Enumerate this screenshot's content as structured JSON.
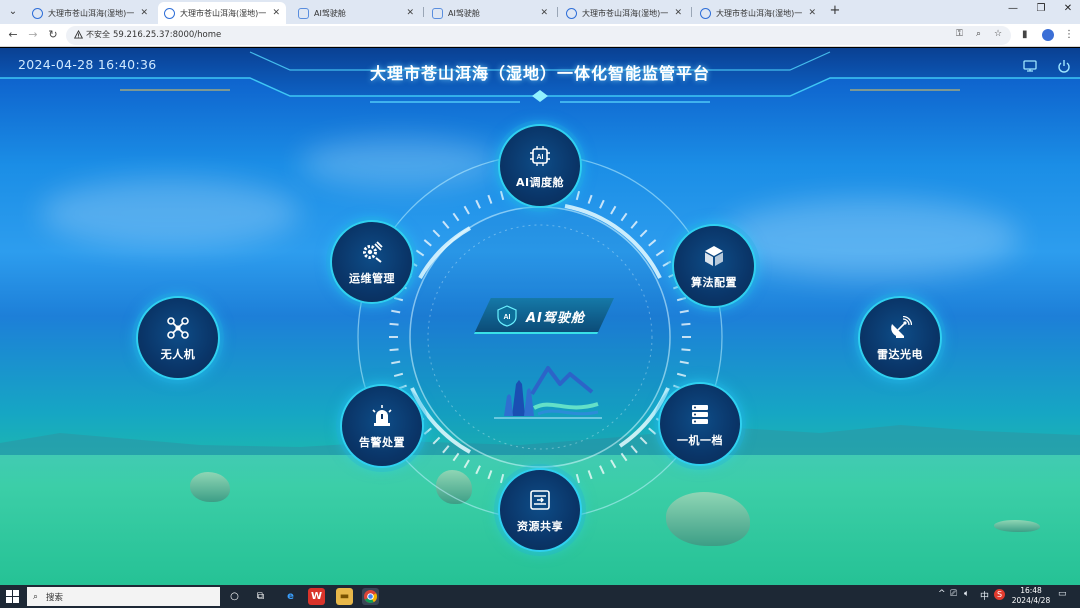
{
  "browser": {
    "tabs": [
      {
        "title": "大理市苍山洱海(湿地)一体化智能",
        "active": false
      },
      {
        "title": "大理市苍山洱海(湿地)一体化智能",
        "active": true
      },
      {
        "title": "AI驾驶舱",
        "active": false
      },
      {
        "title": "AI驾驶舱",
        "active": false
      },
      {
        "title": "大理市苍山洱海(湿地)一体化智能",
        "active": false
      },
      {
        "title": "大理市苍山洱海(湿地)一体化智能",
        "active": false
      }
    ],
    "security_label": "不安全",
    "url": "59.216.25.37:8000/home"
  },
  "header": {
    "datetime": "2024-04-28 16:40:36",
    "title": "大理市苍山洱海（湿地）一体化智能监管平台"
  },
  "center": {
    "label": "AI驾驶舱",
    "logo_text": "AI"
  },
  "modules": [
    {
      "key": "ai-dispatch",
      "label": "AI调度舱",
      "icon": "ai-chip-icon"
    },
    {
      "key": "algorithm",
      "label": "算法配置",
      "icon": "cube-icon"
    },
    {
      "key": "radar",
      "label": "雷达光电",
      "icon": "radar-dish-icon"
    },
    {
      "key": "one-machine",
      "label": "一机一档",
      "icon": "server-icon"
    },
    {
      "key": "resource",
      "label": "资源共享",
      "icon": "share-box-icon"
    },
    {
      "key": "alarm",
      "label": "告警处置",
      "icon": "alarm-light-icon"
    },
    {
      "key": "drone",
      "label": "无人机",
      "icon": "drone-icon"
    },
    {
      "key": "ops",
      "label": "运维管理",
      "icon": "gear-wrench-icon"
    }
  ],
  "taskbar": {
    "search_placeholder": "搜索",
    "ime": "中",
    "time": "16:48",
    "date": "2024/4/28"
  },
  "colors": {
    "accent": "#2fd0f0",
    "node_fill": "#0a3568",
    "title_glow": "#6fd2ff"
  }
}
